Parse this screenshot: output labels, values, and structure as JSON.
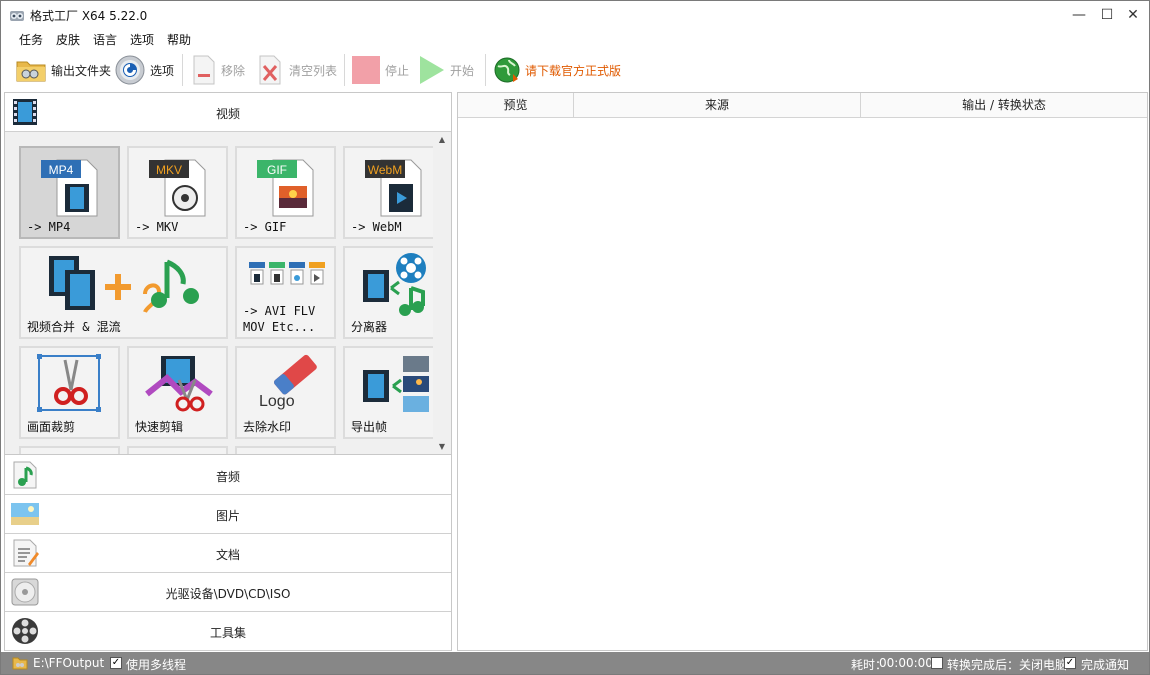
{
  "window": {
    "title": "格式工厂 X64 5.22.0",
    "min": "—",
    "max": "☐",
    "close": "✕"
  },
  "menu": [
    "任务",
    "皮肤",
    "语言",
    "选项",
    "帮助"
  ],
  "toolbar": {
    "output_folder": "输出文件夹",
    "options": "选项",
    "remove": "移除",
    "clear_list": "清空列表",
    "stop": "停止",
    "start": "开始",
    "download_official": "请下载官方正式版"
  },
  "categories": {
    "video": "视频",
    "audio": "音频",
    "image": "图片",
    "document": "文档",
    "disc": "光驱设备\\DVD\\CD\\ISO",
    "tools": "工具集"
  },
  "tiles": {
    "mp4": {
      "label": "-> MP4",
      "badge": "MP4"
    },
    "mkv": {
      "label": "-> MKV",
      "badge": "MKV"
    },
    "gif": {
      "label": "-> GIF",
      "badge": "GIF"
    },
    "webm": {
      "label": "-> WebM",
      "badge": "WebM"
    },
    "merge": {
      "label": "视频合并 & 混流"
    },
    "avi": {
      "label": "-> AVI FLV\nMOV Etc..."
    },
    "splitter": {
      "label": "分离器"
    },
    "crop": {
      "label": "画面裁剪"
    },
    "quick_cut": {
      "label": "快速剪辑"
    },
    "logo_remove": {
      "label": "去除水印",
      "art_text": "Logo"
    },
    "export_frames": {
      "label": "导出帧"
    }
  },
  "table": {
    "headers": [
      "预览",
      "来源",
      "输出 / 转换状态"
    ]
  },
  "status": {
    "output_path": "E:\\FFOutput",
    "multithread": "使用多线程",
    "elapsed_label": "耗时：",
    "elapsed": "00:00:00",
    "after_done": "转换完成后：关闭电脑",
    "notify": "完成通知"
  },
  "colors": {
    "accent_orange": "#e05a00",
    "status_bg": "#878787"
  }
}
